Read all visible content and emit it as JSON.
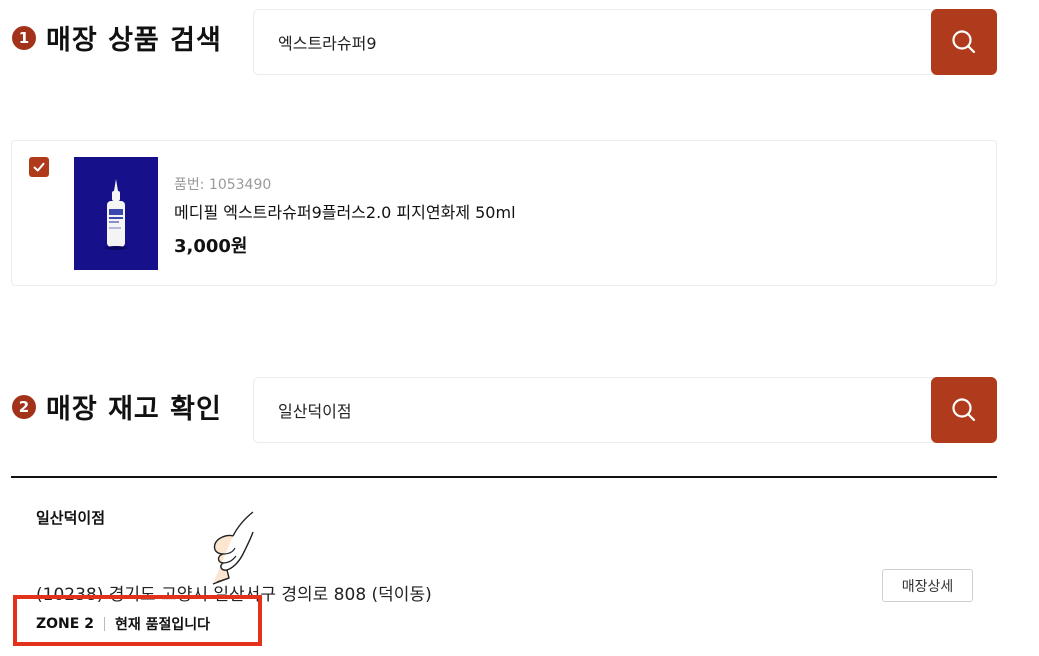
{
  "section1": {
    "badge": "1",
    "title": "매장 상품 검색",
    "search_value": "엑스트라슈퍼9"
  },
  "product": {
    "code": "품번: 1053490",
    "name": "메디필 엑스트라슈퍼9플러스2.0 피지연화제 50ml",
    "price": "3,000원",
    "checked": true
  },
  "section2": {
    "badge": "2",
    "title": "매장 재고 확인",
    "search_value": "일산덕이점"
  },
  "store": {
    "name": "일산덕이점",
    "address": "(10238) 경기도 고양시 일산서구 경의로 808 (덕이동)",
    "detail_button": "매장상세",
    "zone": "ZONE 2",
    "stock_status": "현재 품절입니다"
  },
  "colors": {
    "accent": "#b03a1c",
    "badge": "#a3321b",
    "highlight": "#e2321b",
    "product_thumb_bg": "#16108a"
  },
  "icons": {
    "search": "search-icon",
    "check": "check-icon",
    "pointer": "pointing-hand-icon"
  }
}
